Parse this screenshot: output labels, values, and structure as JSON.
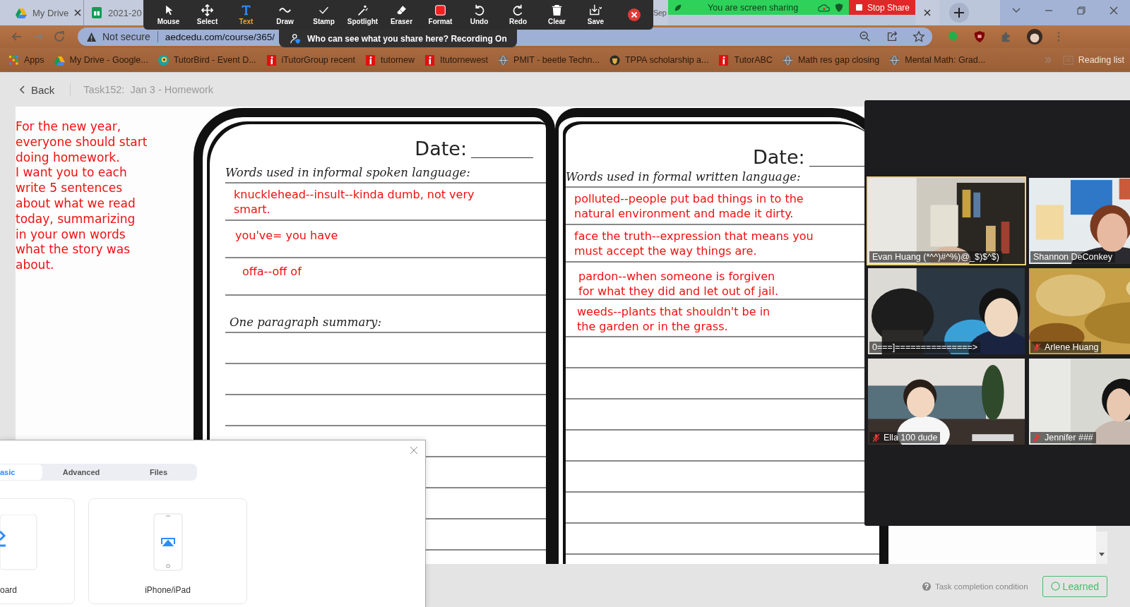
{
  "browser": {
    "tabs": [
      {
        "title": "My Drive",
        "close_button": true
      },
      {
        "title": "2021-20"
      },
      {
        "title": "Sep"
      },
      {
        "close_button": true
      }
    ],
    "address_bar": {
      "security": "Not secure",
      "url": "aedcedu.com/course/365/"
    },
    "bookmarks": [
      {
        "label": "Apps"
      },
      {
        "label": "My Drive - Google..."
      },
      {
        "label": "TutorBird - Event D..."
      },
      {
        "label": "iTutorGroup recent"
      },
      {
        "label": "tutornew"
      },
      {
        "label": "Itutornewest"
      },
      {
        "label": "PMIT - beetle Techn..."
      },
      {
        "label": "TPPA scholarship a..."
      },
      {
        "label": "TutorABC"
      },
      {
        "label": "Math res gap closing"
      },
      {
        "label": "Mental Math: Grad..."
      }
    ],
    "reading_list": "Reading list"
  },
  "annotation_toolbar": {
    "tools": [
      {
        "label": "Mouse",
        "selected": false
      },
      {
        "label": "Select",
        "selected": false
      },
      {
        "label": "Text",
        "selected": true
      },
      {
        "label": "Draw",
        "selected": false
      },
      {
        "label": "Stamp",
        "selected": false
      },
      {
        "label": "Spotlight",
        "selected": false
      },
      {
        "label": "Eraser",
        "selected": false
      },
      {
        "label": "Format",
        "selected": false
      },
      {
        "label": "Undo",
        "selected": false
      },
      {
        "label": "Redo",
        "selected": false
      },
      {
        "label": "Clear",
        "selected": false
      },
      {
        "label": "Save",
        "selected": false
      }
    ],
    "notice": "Who can see what you share here? Recording On"
  },
  "share_banner": {
    "status": "You are screen sharing",
    "stop_button": "Stop Share"
  },
  "page": {
    "back": "Back",
    "title": "Task152:  Jan 3 - Homework",
    "instructions": [
      "For the new year,",
      "everyone should start",
      "doing homework.",
      "I want you to each",
      "write 5 sentences",
      "about what we read",
      "today, summarizing",
      "in your own words",
      "what the story was",
      "about."
    ],
    "worksheet": {
      "pages": [
        {
          "date_label": "Date:",
          "heading": "Words used in informal spoken language:",
          "entries": [
            {
              "lines": [
                "knucklehead--insult--kinda dumb, not very",
                "smart."
              ]
            },
            {
              "lines": [
                "you've= you have"
              ]
            },
            {
              "lines": [
                "offa--off of"
              ]
            }
          ],
          "summary_label": "One paragraph summary:"
        },
        {
          "date_label": "Date:",
          "heading": "Words used in formal written language:",
          "entries": [
            {
              "lines": [
                "polluted--people put bad things in to the",
                "natural environment and made it dirty."
              ]
            },
            {
              "lines": [
                "face the truth--expression that means you",
                "must accept the way things are."
              ]
            },
            {
              "lines": [
                "pardon--when someone is forgiven",
                "for what they did and let out of jail."
              ]
            },
            {
              "lines": [
                "weeds--plants that shouldn't be in",
                "the garden or in the grass."
              ]
            }
          ]
        }
      ]
    },
    "completion_condition": "Task completion condition",
    "learned_button": "Learned"
  },
  "video_panel": {
    "participants": [
      {
        "name": "Evan Huang (*^^)#^%)@_$)$^$)",
        "speaking": true,
        "muted": false
      },
      {
        "name": "Shannon DeConkey",
        "speaking": false,
        "muted": false
      },
      {
        "name": "0===]===============>",
        "speaking": false,
        "muted": false
      },
      {
        "name": "Arlene Huang",
        "speaking": false,
        "muted": true
      },
      {
        "name": "Ella 100 dude",
        "speaking": false,
        "muted": true
      },
      {
        "name": "Jennifer ###",
        "speaking": false,
        "muted": true
      }
    ]
  },
  "dialog": {
    "tabs": [
      {
        "label": "asic",
        "selected": true
      },
      {
        "label": "Advanced",
        "selected": false
      },
      {
        "label": "Files",
        "selected": false
      }
    ],
    "cards": [
      {
        "label": "oard"
      },
      {
        "label": "iPhone/iPad"
      }
    ]
  }
}
